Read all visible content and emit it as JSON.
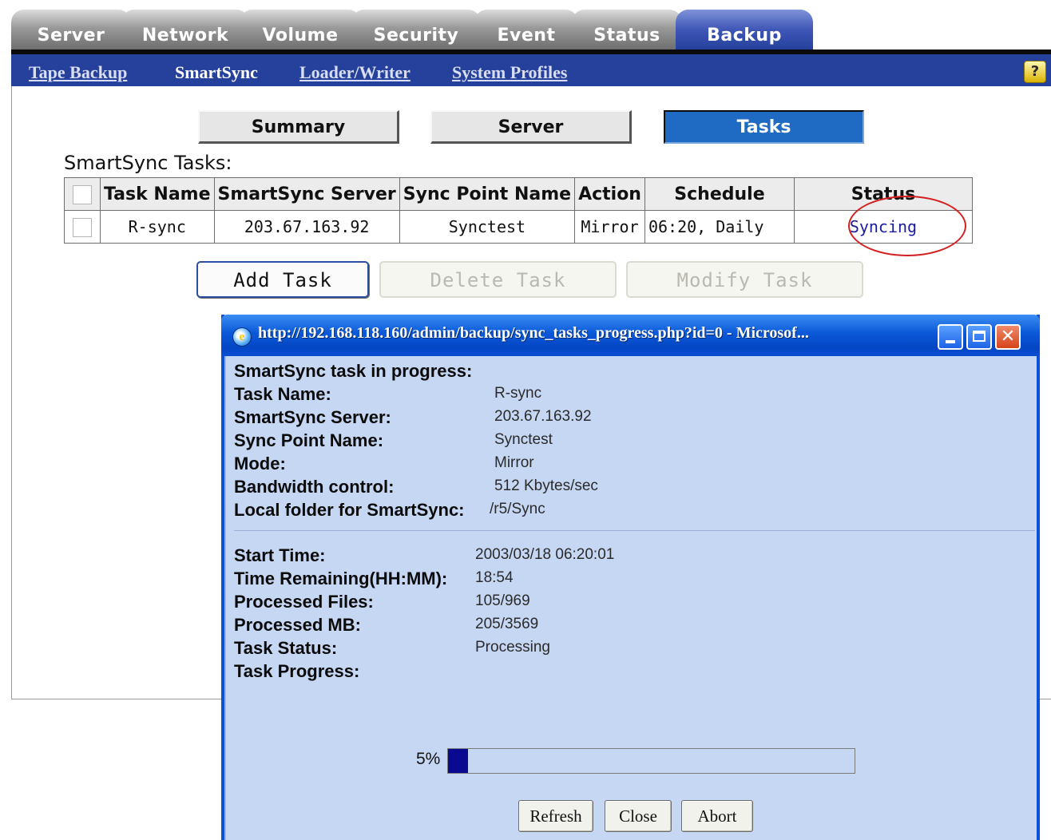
{
  "tabs": [
    "Server",
    "Network",
    "Volume",
    "Security",
    "Event",
    "Status",
    "Backup"
  ],
  "active_tab": "Backup",
  "subnav": [
    "Tape Backup",
    "SmartSync",
    "Loader/Writer",
    "System Profiles"
  ],
  "active_subnav": "SmartSync",
  "help_icon": "?",
  "view_buttons": [
    "Summary",
    "Server",
    "Tasks"
  ],
  "active_view": "Tasks",
  "section_title": "SmartSync Tasks:",
  "table": {
    "headers": [
      "Task Name",
      "SmartSync Server",
      "Sync Point Name",
      "Action",
      "Schedule",
      "Status"
    ],
    "rows": [
      [
        "R-sync",
        "203.67.163.92",
        "Synctest",
        "Mirror",
        "06:20, Daily",
        "Syncing"
      ]
    ]
  },
  "actions": {
    "add": "Add Task",
    "delete": "Delete Task",
    "modify": "Modify Task"
  },
  "popup": {
    "title": "http://192.168.118.160/admin/backup/sync_tasks_progress.php?id=0 - Microsof...",
    "heading": "SmartSync task in progress:",
    "info": [
      {
        "label": "Task Name:",
        "value": "R-sync"
      },
      {
        "label": "SmartSync Server:",
        "value": "203.67.163.92"
      },
      {
        "label": "Sync Point Name:",
        "value": "Synctest"
      },
      {
        "label": "Mode:",
        "value": "Mirror"
      },
      {
        "label": "Bandwidth control:",
        "value": "512 Kbytes/sec"
      },
      {
        "label": "Local folder for SmartSync:",
        "value": "/r5/Sync"
      }
    ],
    "progress_info": [
      {
        "label": "Start Time:",
        "value": "2003/03/18 06:20:01"
      },
      {
        "label": "Time Remaining(HH:MM):",
        "value": "18:54"
      },
      {
        "label": "Processed Files:",
        "value": "105/969"
      },
      {
        "label": "Processed MB:",
        "value": "205/3569"
      },
      {
        "label": "Task Status:",
        "value": "Processing"
      },
      {
        "label": "Task Progress:",
        "value": ""
      }
    ],
    "progress_label": "5%",
    "progress_value": 0.05,
    "buttons": {
      "refresh": "Refresh",
      "close": "Close",
      "abort": "Abort"
    }
  },
  "colors": {
    "active_tab": "#3f57b7",
    "subnav_bg": "#25419b",
    "tasks_button": "#1f6bc3",
    "popup_bg": "#c6d7f4",
    "progress_fill": "#0a0a90",
    "annotation_circle": "#d42020"
  }
}
